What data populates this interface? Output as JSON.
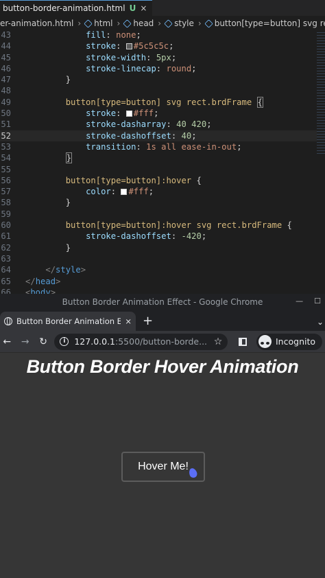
{
  "editor": {
    "tab": {
      "filename": "button-border-animation.html",
      "status": "U",
      "close": "×"
    },
    "breadcrumbs": [
      {
        "label": "er-animation.html",
        "icon": ""
      },
      {
        "label": "html",
        "icon": "element-icon"
      },
      {
        "label": "head",
        "icon": "element-icon"
      },
      {
        "label": "style",
        "icon": "element-icon"
      },
      {
        "label": "button[type=button] svg rect.brdFrame",
        "icon": "selector-icon"
      }
    ],
    "lines": [
      {
        "num": "43",
        "html": "            <span class=\"prop\">fill</span>: <span class=\"val\">none</span>;"
      },
      {
        "num": "44",
        "html": "            <span class=\"prop\">stroke</span>: <span class=\"swatch\" style=\"background:#5c5c5c\"></span><span class=\"val\">#5c5c5c</span>;"
      },
      {
        "num": "45",
        "html": "            <span class=\"prop\">stroke-width</span>: <span class=\"num\">5px</span>;"
      },
      {
        "num": "46",
        "html": "            <span class=\"prop\">stroke-linecap</span>: <span class=\"val\">round</span>;"
      },
      {
        "num": "47",
        "html": "        }"
      },
      {
        "num": "48",
        "html": ""
      },
      {
        "num": "49",
        "html": "        <span class=\"sel\">button[type=button] svg rect.brdFrame</span> <span class=\"bracket-box\">{</span>"
      },
      {
        "num": "50",
        "html": "            <span class=\"prop\">stroke</span>: <span class=\"swatch\" style=\"background:#ffffff\"></span><span class=\"val\">#fff</span>;"
      },
      {
        "num": "51",
        "html": "            <span class=\"prop\">stroke-dasharray</span>: <span class=\"num\">40 420</span>;"
      },
      {
        "num": "52",
        "html": "            <span class=\"prop\">stroke-dashoffset</span>: <span class=\"num\">40</span>;",
        "current": true
      },
      {
        "num": "53",
        "html": "            <span class=\"prop\">transition</span>: <span class=\"val\">1s all ease-in-out</span>;"
      },
      {
        "num": "54",
        "html": "        <span class=\"bracket-box\">}</span>"
      },
      {
        "num": "55",
        "html": ""
      },
      {
        "num": "56",
        "html": "        <span class=\"sel\">button[type=button]:hover</span> {"
      },
      {
        "num": "57",
        "html": "            <span class=\"prop\">color</span>: <span class=\"swatch\" style=\"background:#ffffff\"></span><span class=\"val\">#fff</span>;"
      },
      {
        "num": "58",
        "html": "        }"
      },
      {
        "num": "59",
        "html": ""
      },
      {
        "num": "60",
        "html": "        <span class=\"sel\">button[type=button]:hover svg rect.brdFrame</span> {"
      },
      {
        "num": "61",
        "html": "            <span class=\"prop\">stroke-dashoffset</span>: <span class=\"num\">-420</span>;"
      },
      {
        "num": "62",
        "html": "        }"
      },
      {
        "num": "63",
        "html": ""
      },
      {
        "num": "64",
        "html": "    <span class=\"tag\">&lt;/</span><span class=\"tagname\">style</span><span class=\"tag\">&gt;</span>"
      },
      {
        "num": "65",
        "html": "<span class=\"tag\">&lt;/</span><span class=\"tagname\">head</span><span class=\"tag\">&gt;</span>"
      },
      {
        "num": "66",
        "html": "<span class=\"tag\">&lt;</span><span class=\"tagname\">body</span><span class=\"tag\">&gt;</span>"
      }
    ]
  },
  "chrome": {
    "window_title": "Button Border Animation Effect - Google Chrome",
    "tab_title": "Button Border Animation Effe",
    "tab_close": "×",
    "new_tab": "+",
    "tab_menu": "⌄",
    "url_host": "127.0.0.1",
    "url_rest": ":5500/button-borde...",
    "incognito_label": "Incognito"
  },
  "page": {
    "heading": "Button Border Hover Animation",
    "button_label": "Hover Me!"
  }
}
